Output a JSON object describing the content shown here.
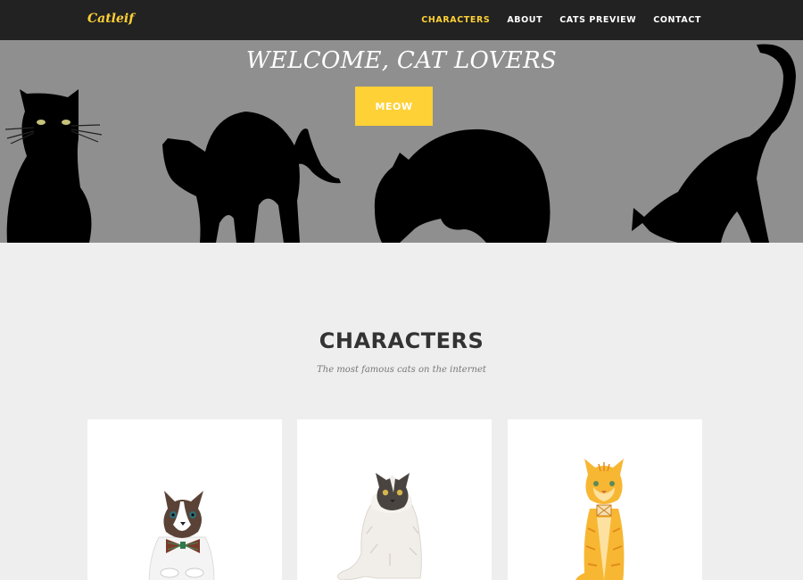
{
  "nav": {
    "brand": "Catleif",
    "items": [
      {
        "label": "CHARACTERS",
        "active": true
      },
      {
        "label": "ABOUT",
        "active": false
      },
      {
        "label": "CATS PREVIEW",
        "active": false
      },
      {
        "label": "CONTACT",
        "active": false
      }
    ]
  },
  "hero": {
    "title": "WELCOME, CAT LOVERS",
    "button": "MEOW"
  },
  "characters": {
    "heading": "CHARACTERS",
    "subheading": "The most famous cats on the internet",
    "cards": [
      {
        "icon": "ragdoll-cat-bowtie-icon"
      },
      {
        "icon": "fluffy-white-cat-icon"
      },
      {
        "icon": "orange-tabby-cat-icon"
      }
    ]
  },
  "colors": {
    "accent": "#fed136",
    "navbar": "#222222",
    "hero_bg": "#8f8f8f",
    "page_bg": "#eeeeee"
  }
}
